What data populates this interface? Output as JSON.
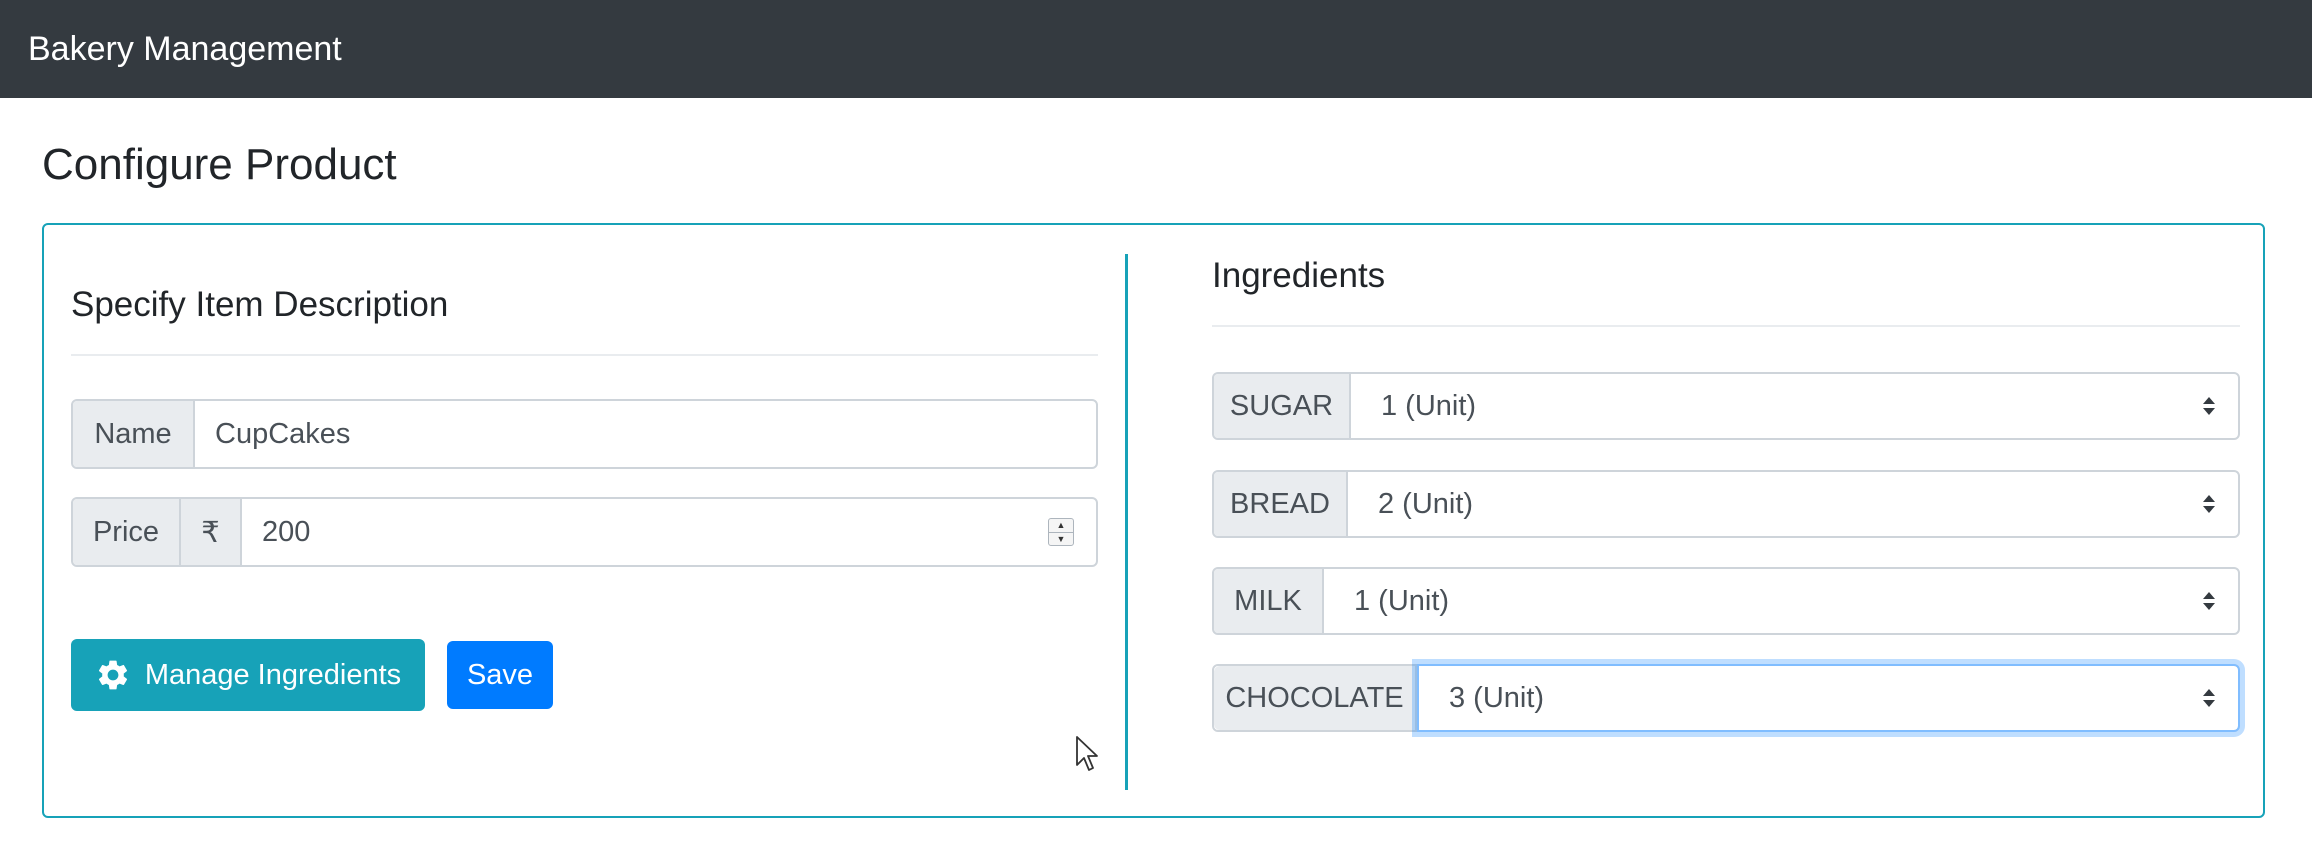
{
  "navbar": {
    "brand": "Bakery Management"
  },
  "page": {
    "title": "Configure Product"
  },
  "item": {
    "heading": "Specify Item Description",
    "name_label": "Name",
    "name_value": "CupCakes",
    "price_label": "Price",
    "currency_symbol": "₹",
    "price_value": "200",
    "manage_ingredients_label": "Manage Ingredients",
    "manage_ingredients_icon": "gear-icon",
    "save_label": "Save"
  },
  "ingredients": {
    "heading": "Ingredients",
    "rows": [
      {
        "label": "SUGAR",
        "value": "1 (Unit)"
      },
      {
        "label": "BREAD",
        "value": "2 (Unit)"
      },
      {
        "label": "MILK",
        "value": "1 (Unit)"
      },
      {
        "label": "CHOCOLATE",
        "value": "3 (Unit)",
        "focused": true
      }
    ]
  },
  "colors": {
    "navbar_bg": "#343a40",
    "card_border": "#17a2b8",
    "info_button": "#17a2b8",
    "primary_button": "#007bff",
    "focus_ring": "#80bdff"
  }
}
